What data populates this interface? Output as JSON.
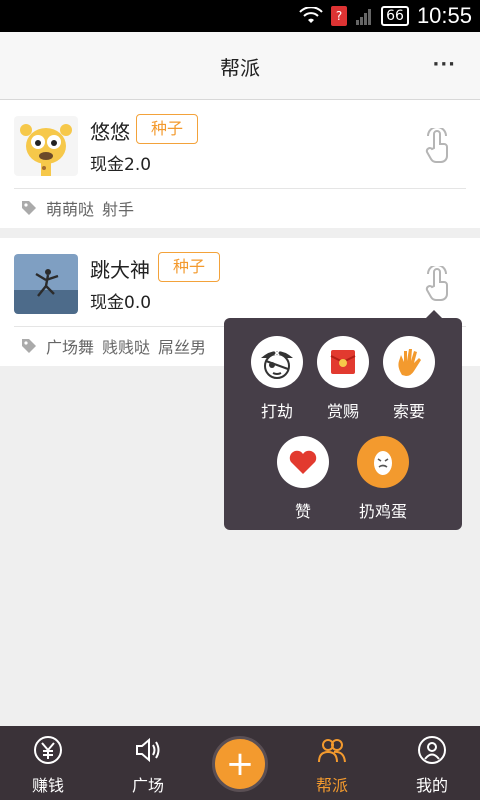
{
  "status_bar": {
    "battery": "66",
    "time": "10:55",
    "sim_badge": "?"
  },
  "header": {
    "title": "帮派",
    "more": "···"
  },
  "members": [
    {
      "name": "悠悠",
      "badge": "种子",
      "cash": "现金2.0",
      "tags": [
        "萌萌哒",
        "射手"
      ]
    },
    {
      "name": "跳大神",
      "badge": "种子",
      "cash": "现金0.0",
      "tags": [
        "广场舞",
        "贱贱哒",
        "屌丝男"
      ]
    }
  ],
  "popup": {
    "actions": [
      {
        "label": "打劫",
        "icon": "pirate-icon"
      },
      {
        "label": "赏赐",
        "icon": "red-envelope-icon"
      },
      {
        "label": "索要",
        "icon": "palm-icon"
      },
      {
        "label": "赞",
        "icon": "heart-icon"
      },
      {
        "label": "扔鸡蛋",
        "icon": "egg-icon"
      }
    ]
  },
  "tabbar": {
    "tabs": [
      {
        "label": "赚钱",
        "icon": "yen-icon"
      },
      {
        "label": "广场",
        "icon": "speaker-icon"
      },
      {
        "label": "帮派",
        "icon": "group-icon",
        "active": true
      },
      {
        "label": "我的",
        "icon": "profile-icon"
      }
    ],
    "plus": "+"
  },
  "colors": {
    "accent": "#f39a2e",
    "tabbar_bg": "#3a3238",
    "popup_bg": "#463e48"
  }
}
